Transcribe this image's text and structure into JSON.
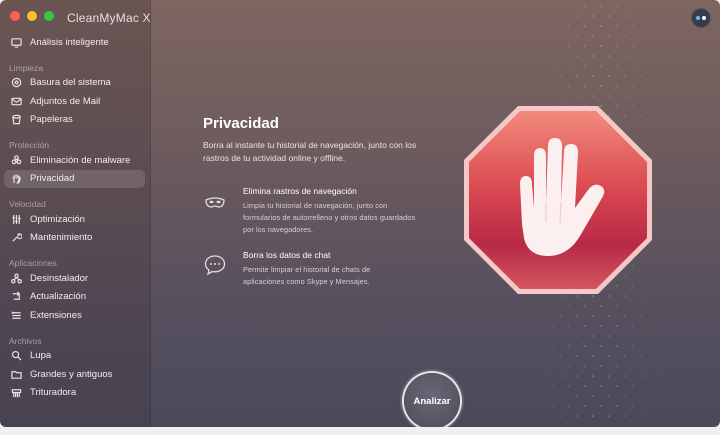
{
  "app": {
    "title": "CleanMyMac X"
  },
  "sidebar": {
    "top_item": {
      "label": "Análisis inteligente",
      "icon": "monitor-icon"
    },
    "sections": [
      {
        "title": "Limpieza",
        "items": [
          {
            "label": "Basura del sistema",
            "icon": "trash-disk-icon"
          },
          {
            "label": "Adjuntos de Mail",
            "icon": "mail-icon"
          },
          {
            "label": "Papeleras",
            "icon": "bin-icon"
          }
        ]
      },
      {
        "title": "Protección",
        "items": [
          {
            "label": "Eliminación de malware",
            "icon": "biohazard-icon"
          },
          {
            "label": "Privacidad",
            "icon": "hand-icon",
            "active": true
          }
        ]
      },
      {
        "title": "Velocidad",
        "items": [
          {
            "label": "Optimización",
            "icon": "sliders-icon"
          },
          {
            "label": "Mantenimiento",
            "icon": "wrench-icon"
          }
        ]
      },
      {
        "title": "Aplicaciones",
        "items": [
          {
            "label": "Desinstalador",
            "icon": "uninstaller-icon"
          },
          {
            "label": "Actualización",
            "icon": "update-icon"
          },
          {
            "label": "Extensiones",
            "icon": "extensions-icon"
          }
        ]
      },
      {
        "title": "Archivos",
        "items": [
          {
            "label": "Lupa",
            "icon": "lens-icon"
          },
          {
            "label": "Grandes y antiguos",
            "icon": "folder-icon"
          },
          {
            "label": "Trituradora",
            "icon": "shredder-icon"
          }
        ]
      }
    ]
  },
  "main": {
    "title": "Privacidad",
    "description": "Borra al instante tu historial de navegación, junto con los rastros de tu actividad online y offline.",
    "features": [
      {
        "title": "Elimina rastros de navegación",
        "description": "Limpia tu historial de navegación, junto con formularios de autorrelleno y otros datos guardados por los navegadores.",
        "icon": "mask-icon"
      },
      {
        "title": "Borra los datos de chat",
        "description": "Permite limpiar el historial de chats de aplicaciones como Skype y Mensajes.",
        "icon": "chat-bubble-icon"
      }
    ],
    "scan_button": "Analizar"
  },
  "colors": {
    "stop_red": "#c8334a",
    "stop_light": "#f07a74",
    "accent": "#55c8f0"
  }
}
